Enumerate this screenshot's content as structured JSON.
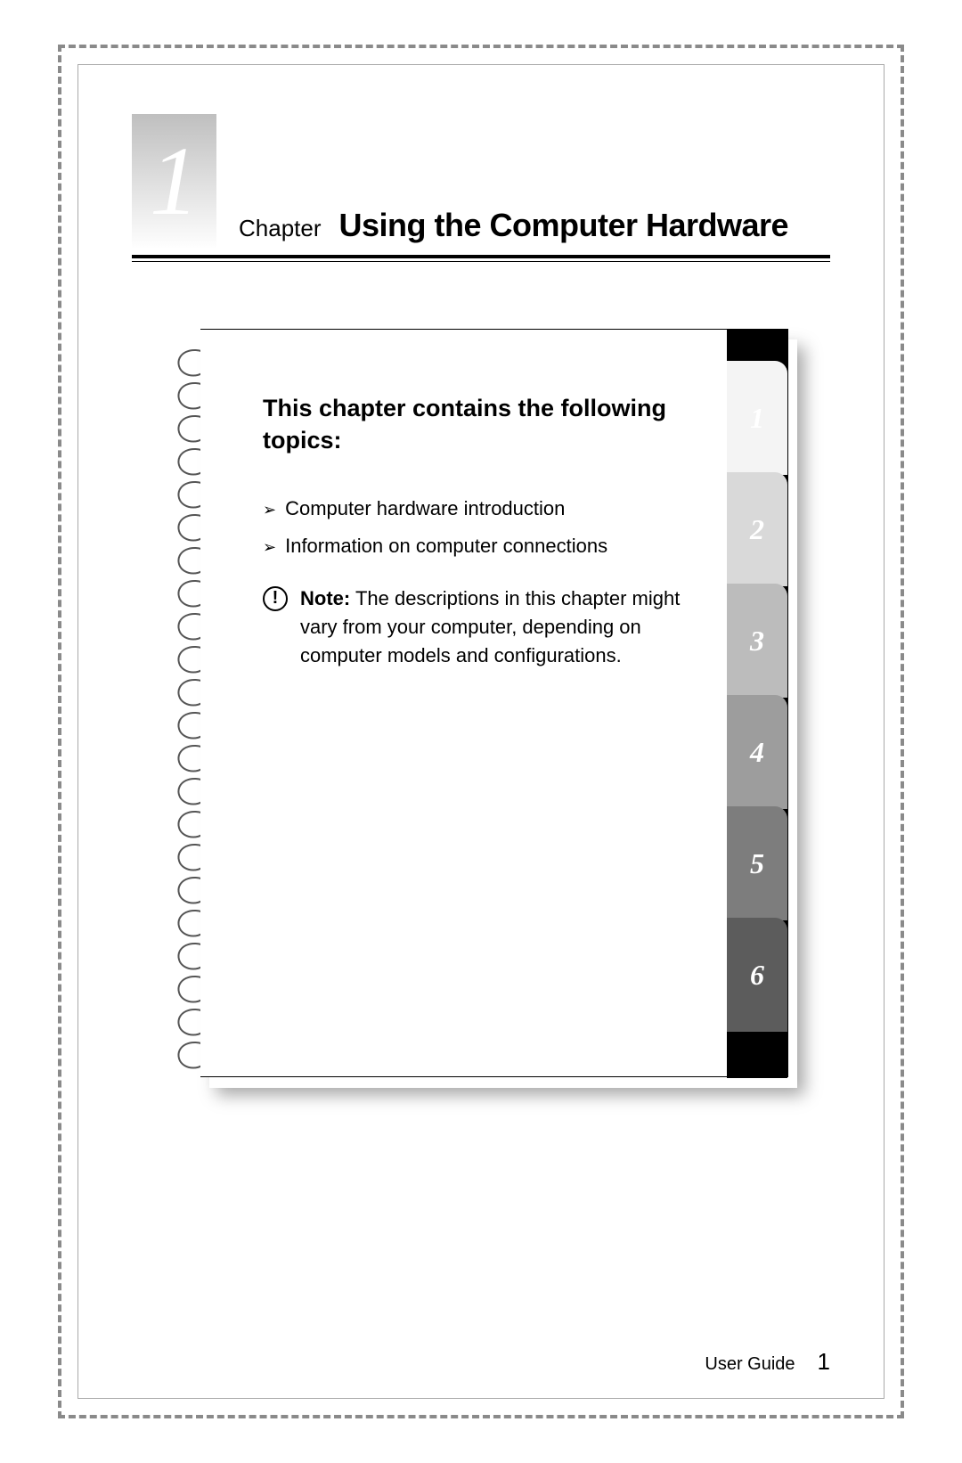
{
  "chapter": {
    "number": "1",
    "label": "Chapter",
    "title": "Using the Computer Hardware"
  },
  "topics": {
    "heading": "This chapter contains the following topics:",
    "items": [
      "Computer hardware introduction",
      "Information on computer connections"
    ]
  },
  "note": {
    "label": "Note:",
    "text": "The descriptions in this chapter might vary from your computer, depending on computer models and configurations."
  },
  "tabs": [
    "1",
    "2",
    "3",
    "4",
    "5",
    "6"
  ],
  "footer": {
    "label": "User Guide",
    "page": "1"
  }
}
